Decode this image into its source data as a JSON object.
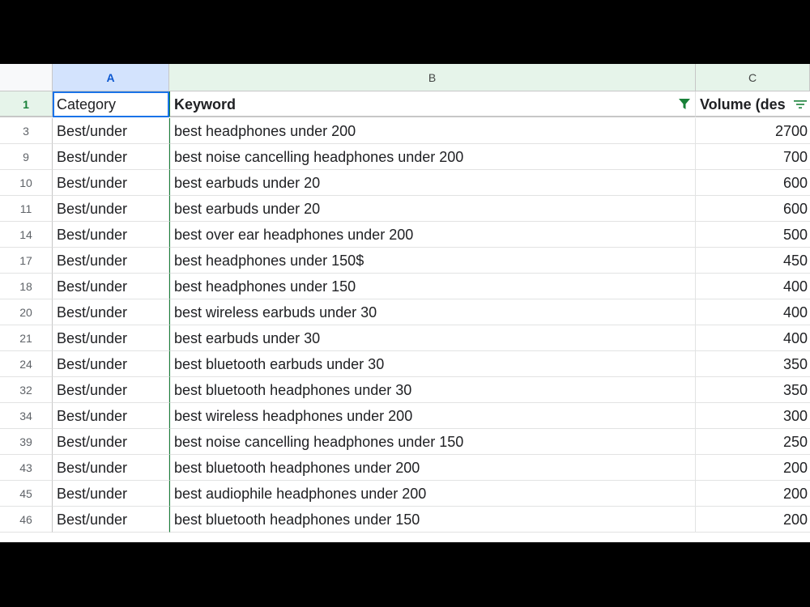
{
  "columns": {
    "a": "A",
    "b": "B",
    "c": "C"
  },
  "header_row": {
    "num": "1",
    "category": "Category",
    "keyword": "Keyword",
    "volume": "Volume (des"
  },
  "rows": [
    {
      "num": "3",
      "category": "Best/under",
      "keyword": "best headphones under 200",
      "volume": "2700"
    },
    {
      "num": "9",
      "category": "Best/under",
      "keyword": "best noise cancelling headphones under 200",
      "volume": "700"
    },
    {
      "num": "10",
      "category": "Best/under",
      "keyword": "best earbuds under 20",
      "volume": "600"
    },
    {
      "num": "11",
      "category": "Best/under",
      "keyword": "best earbuds under 20",
      "volume": "600"
    },
    {
      "num": "14",
      "category": "Best/under",
      "keyword": "best over ear headphones under 200",
      "volume": "500"
    },
    {
      "num": "17",
      "category": "Best/under",
      "keyword": "best headphones under 150$",
      "volume": "450"
    },
    {
      "num": "18",
      "category": "Best/under",
      "keyword": "best headphones under 150",
      "volume": "400"
    },
    {
      "num": "20",
      "category": "Best/under",
      "keyword": "best wireless earbuds under 30",
      "volume": "400"
    },
    {
      "num": "21",
      "category": "Best/under",
      "keyword": "best earbuds under 30",
      "volume": "400"
    },
    {
      "num": "24",
      "category": "Best/under",
      "keyword": "best bluetooth earbuds under 30",
      "volume": "350"
    },
    {
      "num": "32",
      "category": "Best/under",
      "keyword": "best bluetooth headphones under 30",
      "volume": "350"
    },
    {
      "num": "34",
      "category": "Best/under",
      "keyword": "best wireless headphones under 200",
      "volume": "300"
    },
    {
      "num": "39",
      "category": "Best/under",
      "keyword": "best noise cancelling headphones under 150",
      "volume": "250"
    },
    {
      "num": "43",
      "category": "Best/under",
      "keyword": "best bluetooth headphones under 200",
      "volume": "200"
    },
    {
      "num": "45",
      "category": "Best/under",
      "keyword": "best audiophile headphones under 200",
      "volume": "200"
    },
    {
      "num": "46",
      "category": "Best/under",
      "keyword": "best bluetooth headphones under 150",
      "volume": "200"
    }
  ],
  "icons": {
    "keyword_filter": "filter-funnel-icon",
    "volume_sort": "sort-filter-icon"
  },
  "colors": {
    "filter_green": "#188038",
    "header_green": "#e6f4ea",
    "selected_col": "#d3e3fd",
    "selection": "#1a73e8"
  }
}
